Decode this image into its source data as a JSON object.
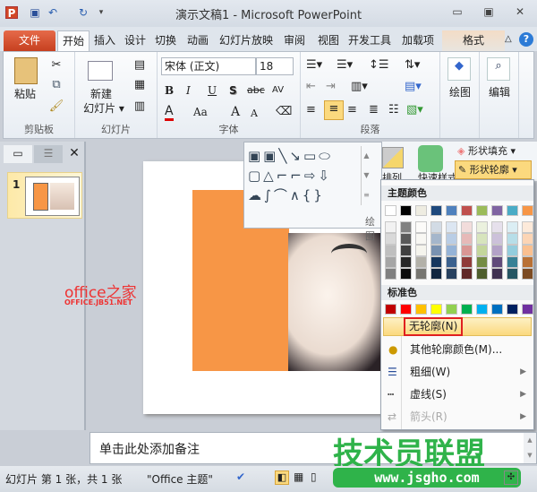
{
  "titlebar": {
    "title": "演示文稿1 - Microsoft PowerPoint",
    "app_icon": "P",
    "minimize": "▭",
    "restore": "▣",
    "close": "✕"
  },
  "tabs": [
    "文件",
    "开始",
    "插入",
    "设计",
    "切换",
    "动画",
    "幻灯片放映",
    "审阅",
    "视图",
    "开发工具",
    "加载项",
    "格式"
  ],
  "ribbon": {
    "clipboard": {
      "paste": "粘贴",
      "label": "剪贴板"
    },
    "slides": {
      "new1": "新建",
      "new2": "幻灯片 ▾",
      "label": "幻灯片"
    },
    "font": {
      "name": "宋体 (正文)",
      "size": "18",
      "bold": "B",
      "italic": "I",
      "underline": "U",
      "shadow": "S",
      "strike": "abc",
      "spacing": "AV",
      "color": "A",
      "case": "Aa",
      "grow": "A",
      "shrink": "A",
      "label": "字体"
    },
    "paragraph": {
      "label": "段落"
    },
    "drawing": {
      "label": "绘图",
      "arrange": "排列",
      "quickstyle": "快速样式",
      "fill": "形状填充",
      "outline": "形状轮廓",
      "draw_btn": "绘图"
    },
    "editing": {
      "label": "编辑"
    }
  },
  "slide_panel": {
    "number": "1"
  },
  "watermark": {
    "line1": "office之家",
    "line2": "OFFICE.JB51.NET",
    "logo": "技术员联盟",
    "url": "www.jsgho.com"
  },
  "outline_menu": {
    "theme_header": "主题颜色",
    "theme_colors": [
      "#FFFFFF",
      "#000000",
      "#EEECE1",
      "#1F497D",
      "#4F81BD",
      "#C0504D",
      "#9BBB59",
      "#8064A2",
      "#4BACC6",
      "#F79646"
    ],
    "standard_header": "标准色",
    "standard_colors": [
      "#C00000",
      "#FF0000",
      "#FFC000",
      "#FFFF00",
      "#92D050",
      "#00B050",
      "#00B0F0",
      "#0070C0",
      "#002060",
      "#7030A0"
    ],
    "items": [
      {
        "label": "无轮廓(N)",
        "highlighted": true
      },
      {
        "label": "其他轮廓颜色(M)..."
      },
      {
        "label": "粗细(W)",
        "submenu": true
      },
      {
        "label": "虚线(S)",
        "submenu": true
      },
      {
        "label": "箭头(R)",
        "submenu": true,
        "disabled": true
      }
    ]
  },
  "notes": {
    "placeholder": "单击此处添加备注"
  },
  "statusbar": {
    "slide_info": "幻灯片 第 1 张，共 1 张",
    "theme": "\"Office 主题\""
  },
  "colors": {
    "accent_orange": "#F79646",
    "file_tab": "#D24726",
    "highlight": "#FCE4A0",
    "red_box": "#E02020"
  }
}
